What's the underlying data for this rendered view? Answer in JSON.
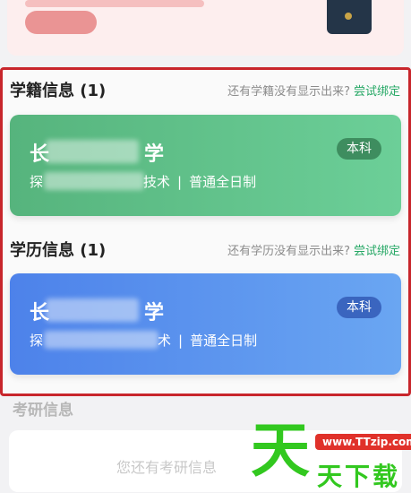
{
  "enrollment": {
    "title": "学籍信息 (1)",
    "hint": "还有学籍没有显示出来?",
    "link": "尝试绑定",
    "card": {
      "school_start": "长",
      "school_end": "学",
      "level": "本科",
      "major_start": "探",
      "major_end": "技术",
      "study_type": "普通全日制"
    }
  },
  "education": {
    "title": "学历信息 (1)",
    "hint": "还有学历没有显示出来?",
    "link": "尝试绑定",
    "card": {
      "school_start": "长",
      "school_end": "学",
      "level": "本科",
      "major_start": "探",
      "major_end": "术",
      "study_type": "普通全日制"
    }
  },
  "separator": "|",
  "next_section": {
    "title": "考研信息",
    "empty_text": "您还有考研信息"
  },
  "watermark": {
    "big": "天",
    "url": "www.TTzip.com",
    "small": "天下载"
  },
  "colors": {
    "highlight_border": "#c8262c",
    "green_card": "#5cbf86",
    "blue_card": "#5a94ee",
    "link": "#27a866"
  }
}
